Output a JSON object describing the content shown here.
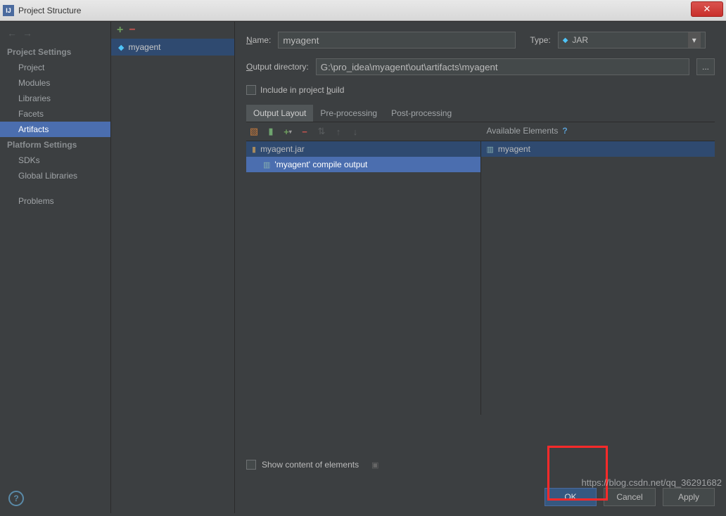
{
  "window": {
    "title": "Project Structure",
    "close_glyph": "✕"
  },
  "sidebar": {
    "section1": "Project Settings",
    "items1": [
      "Project",
      "Modules",
      "Libraries",
      "Facets",
      "Artifacts"
    ],
    "section2": "Platform Settings",
    "items2": [
      "SDKs",
      "Global Libraries"
    ],
    "items3": [
      "Problems"
    ]
  },
  "artifacts_list": {
    "selected": "myagent"
  },
  "form": {
    "name_label": "Name:",
    "name_value": "myagent",
    "type_label": "Type:",
    "type_value": "JAR",
    "outdir_label": "Output directory:",
    "outdir_value": "G:\\pro_idea\\myagent\\out\\artifacts\\myagent",
    "ellipsis": "...",
    "include_label": "Include in project build",
    "tabs": [
      "Output Layout",
      "Pre-processing",
      "Post-processing"
    ],
    "available_header": "Available Elements",
    "tree_left_root": "myagent.jar",
    "tree_left_child": "'myagent' compile output",
    "tree_right_root": "myagent",
    "show_content": "Show content of elements"
  },
  "buttons": {
    "ok": "OK",
    "cancel": "Cancel",
    "apply": "Apply"
  },
  "watermark": "https://blog.csdn.net/qq_36291682"
}
